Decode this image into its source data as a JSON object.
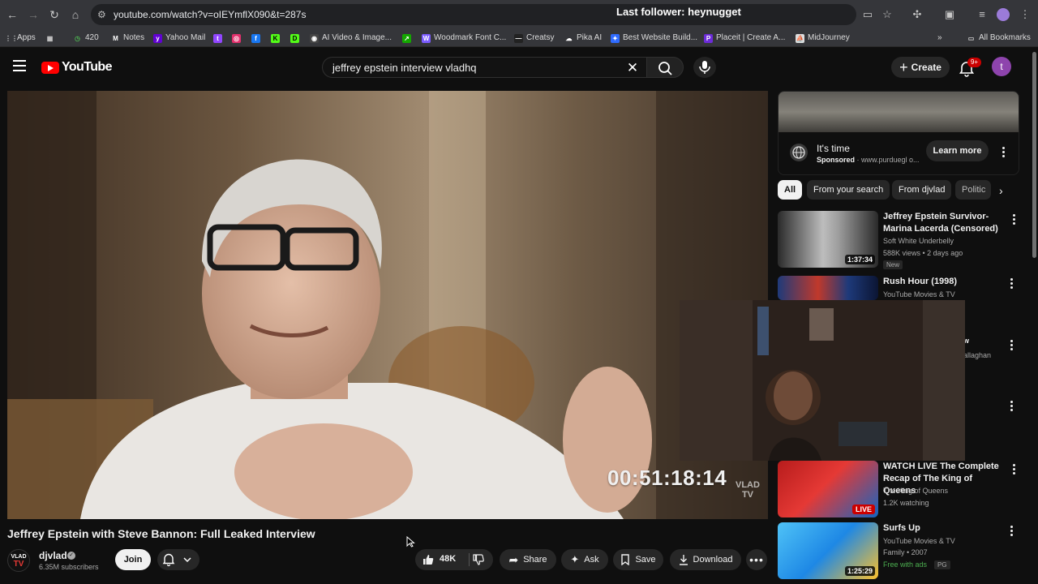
{
  "browser": {
    "url": "youtube.com/watch?v=oIEYmflX090&t=287s",
    "overlay_text": "Last follower: heynugget",
    "bookmarks": [
      {
        "label": "Apps",
        "icon": "apps-grid-icon",
        "color": "#cccccc"
      },
      {
        "label": "",
        "icon": "tab-groups-icon",
        "color": "#cccccc"
      },
      {
        "label": "420",
        "icon": "clock-icon",
        "color": "#4caf50"
      },
      {
        "label": "Notes",
        "icon": "notes-icon",
        "color": "#ffffff"
      },
      {
        "label": "Yahoo Mail",
        "icon": "yahoo-icon",
        "color": "#6001d2"
      },
      {
        "label": "",
        "icon": "twitch-icon",
        "color": "#9146ff"
      },
      {
        "label": "",
        "icon": "instagram-icon",
        "color": "#e1306c"
      },
      {
        "label": "",
        "icon": "facebook-icon",
        "color": "#1877f2"
      },
      {
        "label": "",
        "icon": "kick-icon",
        "color": "#53fc18"
      },
      {
        "label": "",
        "icon": "d-icon",
        "color": "#53fc18"
      },
      {
        "label": "AI Video & Image...",
        "icon": "openai-icon",
        "color": "#444444"
      },
      {
        "label": "",
        "icon": "upwork-icon",
        "color": "#14a800"
      },
      {
        "label": "Woodmark Font C...",
        "icon": "font-icon",
        "color": "#7b5cff"
      },
      {
        "label": "Creatsy",
        "icon": "creatsy-icon",
        "color": "#222222"
      },
      {
        "label": "Pika AI",
        "icon": "pika-icon",
        "color": "#ffffff"
      },
      {
        "label": "Best Website Build...",
        "icon": "website-builder-icon",
        "color": "#2f6bff"
      },
      {
        "label": "Placeit | Create A...",
        "icon": "placeit-icon",
        "color": "#6c2bd9"
      },
      {
        "label": "MidJourney",
        "icon": "midjourney-icon",
        "color": "#dddddd"
      }
    ],
    "all_bookmarks": "All Bookmarks"
  },
  "header": {
    "logo_text": "YouTube",
    "search_query": "jeffrey epstein interview vladhq",
    "create_label": "Create",
    "notification_count": "9+",
    "avatar_letter": "t"
  },
  "player": {
    "timecode": "00:51:18:14",
    "watermark_line1": "VLAD",
    "watermark_line2": "TV"
  },
  "video": {
    "title": "Jeffrey Epstein with Steve Bannon: Full Leaked Interview",
    "channel": {
      "name": "djvlad",
      "subscribers": "6.35M subscribers",
      "avatar_line1": "VLAD",
      "avatar_line2": "TV"
    },
    "join_label": "Join",
    "like_count": "48K",
    "actions": {
      "share": "Share",
      "ask": "Ask",
      "save": "Save",
      "download": "Download"
    }
  },
  "sidebar": {
    "ad": {
      "title": "It's time",
      "sponsored_label": "Sponsored",
      "domain": "www.purduegl o...",
      "cta": "Learn more"
    },
    "chips": [
      "All",
      "From your search",
      "From djvlad",
      "Politic"
    ],
    "recommendations": [
      {
        "title": "Jeffrey Epstein Survivor-Marina Lacerda (Censored)",
        "channel": "Soft White Underbelly",
        "meta": "588K views • 2 days ago",
        "badge": "New",
        "duration": "1:37:34",
        "thumb_color": "#bdbdbd"
      },
      {
        "title": "Rush Hour (1998)",
        "channel": "YouTube Movies & TV",
        "meta": "",
        "badge": "",
        "duration": "",
        "thumb_color": "#3a4a8a"
      },
      {
        "title": "w",
        "channel": "allaghan",
        "meta": "",
        "badge": "",
        "duration": "",
        "thumb_color": "#2a1f1a"
      },
      {
        "title": "",
        "channel": "",
        "meta": "",
        "badge": "",
        "duration": "",
        "thumb_color": "#2a1f1a"
      },
      {
        "title": "WATCH LIVE The Complete Recap of The King of Queens",
        "channel": "The King of Queens",
        "meta": "1.2K watching",
        "badge": "",
        "live": "LIVE",
        "thumb_color": "#c62828"
      },
      {
        "title": "Surfs Up",
        "channel": "YouTube Movies & TV",
        "meta": "Family • 2007",
        "free": "Free with ads",
        "rating": "PG",
        "duration": "1:25:29",
        "thumb_color": "#2e7dbf"
      }
    ]
  }
}
